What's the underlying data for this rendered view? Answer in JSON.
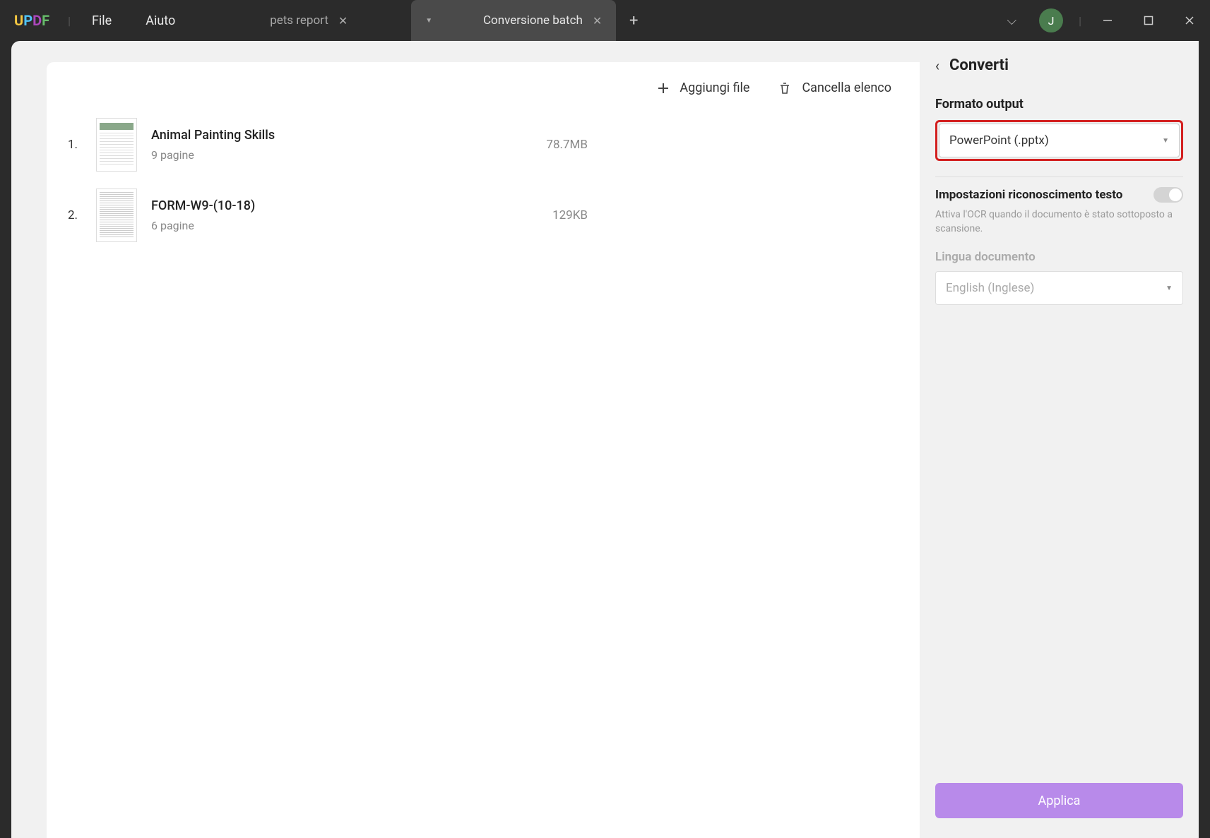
{
  "menu": {
    "file": "File",
    "help": "Aiuto"
  },
  "tabs": [
    {
      "label": "pets report",
      "active": false
    },
    {
      "label": "Conversione batch",
      "active": true
    }
  ],
  "avatar_initial": "J",
  "toolbar": {
    "add": "Aggiungi file",
    "clear": "Cancella elenco"
  },
  "files": [
    {
      "idx": "1.",
      "name": "Animal Painting Skills",
      "pages": "9 pagine",
      "size": "78.7MB"
    },
    {
      "idx": "2.",
      "name": "FORM-W9-(10-18)",
      "pages": "6 pagine",
      "size": "129KB"
    }
  ],
  "side": {
    "title": "Converti",
    "format_label": "Formato output",
    "format_value": "PowerPoint (.pptx)",
    "ocr_label": "Impostazioni riconoscimento testo",
    "ocr_desc": "Attiva l'OCR quando il documento è stato sottoposto a scansione.",
    "lang_label": "Lingua documento",
    "lang_value": "English (Inglese)",
    "apply": "Applica"
  }
}
